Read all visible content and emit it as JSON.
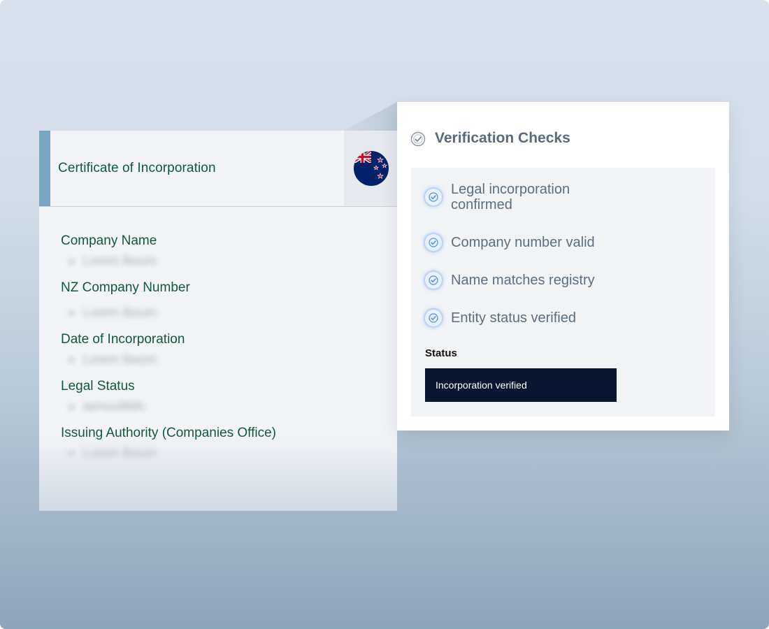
{
  "certificate": {
    "title": "Certificate of Incorporation",
    "flag_icon": "new-zealand-flag-icon",
    "fields": [
      {
        "label": "Company Name",
        "value": "Lorem Ibsum"
      },
      {
        "label": "NZ Company Number",
        "value": "Lorem Ibsum"
      },
      {
        "label": "Date of Incorporation",
        "value": "Lorem Ibsum"
      },
      {
        "label": "Legal Status",
        "value": "aenuudlidn"
      },
      {
        "label": "Issuing Authority (Companies Office)",
        "value": "Lorem Ibsum"
      }
    ]
  },
  "verification": {
    "title": "Verification Checks",
    "checks": [
      {
        "text": "Legal incorporation confirmed"
      },
      {
        "text": "Company number valid"
      },
      {
        "text": "Name matches registry"
      },
      {
        "text": "Entity status verified"
      }
    ],
    "status_label": "Status",
    "status_value": "Incorporation verified"
  },
  "colors": {
    "accent_green": "#0f5a3c",
    "accent_blue": "#7aa6c2",
    "status_bg": "#0b1630",
    "check_blue": "#4a8ef0"
  }
}
